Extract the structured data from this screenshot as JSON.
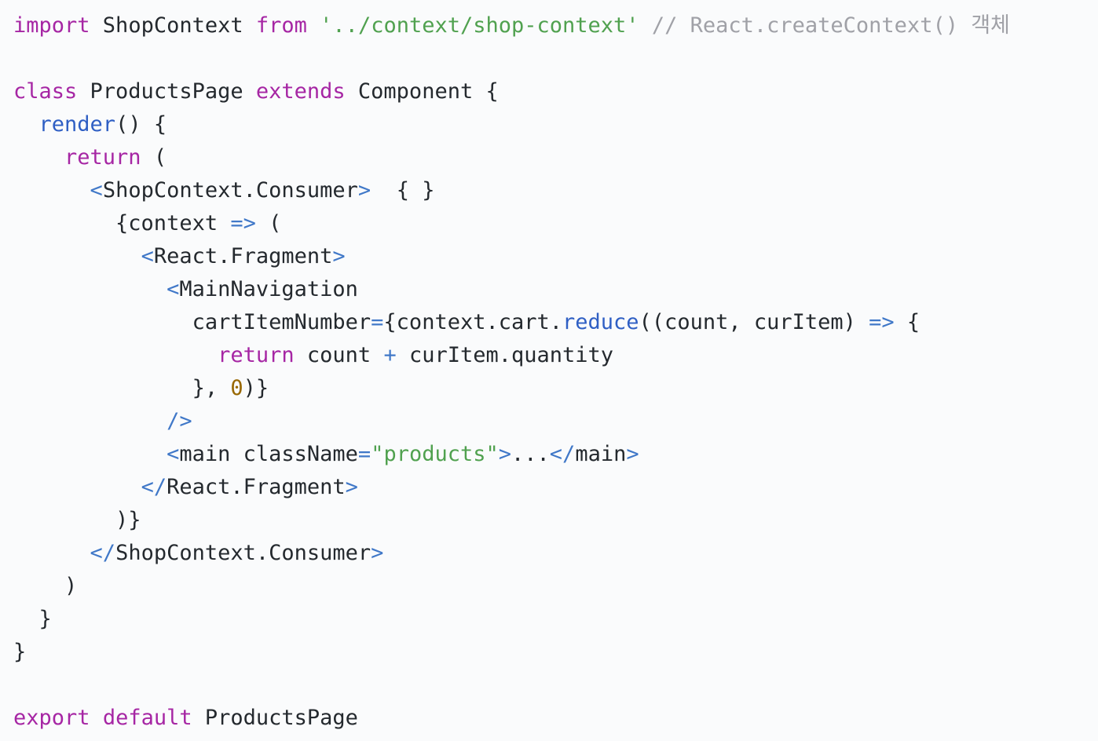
{
  "editor": {
    "background": "#fafbfc",
    "colors": {
      "keyword": "#a626a4",
      "function": "#2f5fc4",
      "string": "#50a14f",
      "comment": "#a0a1a7",
      "tag": "#4078c8",
      "number": "#986801",
      "text": "#24292e"
    },
    "lines": [
      {
        "tokens": [
          {
            "t": "kw",
            "v": "import"
          },
          {
            "t": "plain",
            "v": " ShopContext "
          },
          {
            "t": "kw",
            "v": "from"
          },
          {
            "t": "plain",
            "v": " "
          },
          {
            "t": "str",
            "v": "'../context/shop-context'"
          },
          {
            "t": "plain",
            "v": " "
          },
          {
            "t": "com",
            "v": "// React.createContext() 객체"
          }
        ]
      },
      {
        "tokens": []
      },
      {
        "tokens": [
          {
            "t": "kw",
            "v": "class"
          },
          {
            "t": "plain",
            "v": " ProductsPage "
          },
          {
            "t": "kw",
            "v": "extends"
          },
          {
            "t": "plain",
            "v": " Component {"
          }
        ]
      },
      {
        "tokens": [
          {
            "t": "plain",
            "v": "  "
          },
          {
            "t": "fn",
            "v": "render"
          },
          {
            "t": "plain",
            "v": "() {"
          }
        ]
      },
      {
        "tokens": [
          {
            "t": "plain",
            "v": "    "
          },
          {
            "t": "kw",
            "v": "return"
          },
          {
            "t": "plain",
            "v": " ("
          }
        ]
      },
      {
        "tokens": [
          {
            "t": "plain",
            "v": "      "
          },
          {
            "t": "tag",
            "v": "<"
          },
          {
            "t": "plain",
            "v": "ShopContext.Consumer"
          },
          {
            "t": "tag",
            "v": ">"
          },
          {
            "t": "plain",
            "v": "  { }"
          }
        ]
      },
      {
        "tokens": [
          {
            "t": "plain",
            "v": "        {context "
          },
          {
            "t": "op",
            "v": "=>"
          },
          {
            "t": "plain",
            "v": " ("
          }
        ]
      },
      {
        "tokens": [
          {
            "t": "plain",
            "v": "          "
          },
          {
            "t": "tag",
            "v": "<"
          },
          {
            "t": "plain",
            "v": "React.Fragment"
          },
          {
            "t": "tag",
            "v": ">"
          }
        ]
      },
      {
        "tokens": [
          {
            "t": "plain",
            "v": "            "
          },
          {
            "t": "tag",
            "v": "<"
          },
          {
            "t": "plain",
            "v": "MainNavigation"
          }
        ]
      },
      {
        "tokens": [
          {
            "t": "plain",
            "v": "              cartItemNumber"
          },
          {
            "t": "op",
            "v": "="
          },
          {
            "t": "plain",
            "v": "{context.cart."
          },
          {
            "t": "fn",
            "v": "reduce"
          },
          {
            "t": "plain",
            "v": "((count, curItem) "
          },
          {
            "t": "op",
            "v": "=>"
          },
          {
            "t": "plain",
            "v": " {"
          }
        ]
      },
      {
        "tokens": [
          {
            "t": "plain",
            "v": "                "
          },
          {
            "t": "kw",
            "v": "return"
          },
          {
            "t": "plain",
            "v": " count "
          },
          {
            "t": "op",
            "v": "+"
          },
          {
            "t": "plain",
            "v": " curItem.quantity"
          }
        ]
      },
      {
        "tokens": [
          {
            "t": "plain",
            "v": "              }, "
          },
          {
            "t": "num",
            "v": "0"
          },
          {
            "t": "plain",
            "v": ")}"
          }
        ]
      },
      {
        "tokens": [
          {
            "t": "plain",
            "v": "            "
          },
          {
            "t": "tag",
            "v": "/>"
          }
        ]
      },
      {
        "tokens": [
          {
            "t": "plain",
            "v": "            "
          },
          {
            "t": "tag",
            "v": "<"
          },
          {
            "t": "plain",
            "v": "main className"
          },
          {
            "t": "op",
            "v": "="
          },
          {
            "t": "str",
            "v": "\"products\""
          },
          {
            "t": "tag",
            "v": ">"
          },
          {
            "t": "plain",
            "v": "..."
          },
          {
            "t": "tag",
            "v": "</"
          },
          {
            "t": "plain",
            "v": "main"
          },
          {
            "t": "tag",
            "v": ">"
          }
        ]
      },
      {
        "tokens": [
          {
            "t": "plain",
            "v": "          "
          },
          {
            "t": "tag",
            "v": "</"
          },
          {
            "t": "plain",
            "v": "React.Fragment"
          },
          {
            "t": "tag",
            "v": ">"
          }
        ]
      },
      {
        "tokens": [
          {
            "t": "plain",
            "v": "        )}"
          }
        ]
      },
      {
        "tokens": [
          {
            "t": "plain",
            "v": "      "
          },
          {
            "t": "tag",
            "v": "</"
          },
          {
            "t": "plain",
            "v": "ShopContext.Consumer"
          },
          {
            "t": "tag",
            "v": ">"
          }
        ]
      },
      {
        "tokens": [
          {
            "t": "plain",
            "v": "    )"
          }
        ]
      },
      {
        "tokens": [
          {
            "t": "plain",
            "v": "  }"
          }
        ]
      },
      {
        "tokens": [
          {
            "t": "plain",
            "v": "}"
          }
        ]
      },
      {
        "tokens": []
      },
      {
        "tokens": [
          {
            "t": "kw",
            "v": "export"
          },
          {
            "t": "plain",
            "v": " "
          },
          {
            "t": "kw",
            "v": "default"
          },
          {
            "t": "plain",
            "v": " ProductsPage"
          }
        ]
      }
    ]
  }
}
